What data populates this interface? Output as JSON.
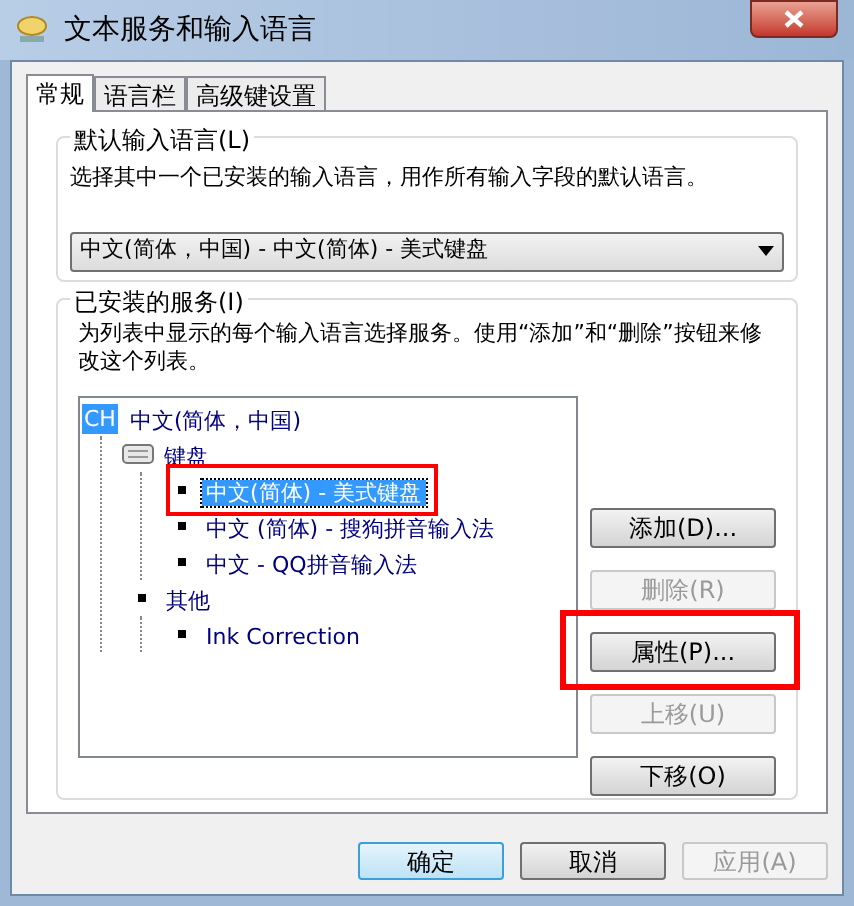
{
  "window": {
    "title": "文本服务和输入语言"
  },
  "tabs": [
    {
      "label": "常规",
      "selected": true
    },
    {
      "label": "语言栏",
      "selected": false
    },
    {
      "label": "高级键设置",
      "selected": false
    }
  ],
  "default_language": {
    "title": "默认输入语言(L)",
    "description": "选择其中一个已安装的输入语言，用作所有输入字段的默认语言。",
    "dropdown": {
      "value": "中文(简体，中国) - 中文(简体) - 美式键盘"
    }
  },
  "installed_services": {
    "title": "已安装的服务(I)",
    "description": "为列表中显示的每个输入语言选择服务。使用“添加”和“删除”按钮来修改这个列表。",
    "tree": [
      {
        "badge": "CH",
        "label": "中文(简体，中国)",
        "kind": "language",
        "selected": false,
        "highlighted": false,
        "children": [
          {
            "label": "键盘",
            "kind": "keyboard",
            "selected": false,
            "highlighted": false,
            "children": [
              {
                "label": "中文(简体) - 美式键盘",
                "kind": "item",
                "selected": true,
                "highlighted": true
              },
              {
                "label": "中文 (简体) - 搜狗拼音输入法",
                "kind": "item",
                "selected": false,
                "highlighted": false
              },
              {
                "label": "中文 - QQ拼音输入法",
                "kind": "item",
                "selected": false,
                "highlighted": false
              }
            ]
          },
          {
            "label": "其他",
            "kind": "item",
            "selected": false,
            "highlighted": false,
            "children": [
              {
                "label": "Ink Correction",
                "kind": "item",
                "selected": false,
                "highlighted": false
              }
            ]
          }
        ]
      }
    ],
    "buttons": [
      {
        "label": "添加(D)...",
        "disabled": false,
        "highlighted": false
      },
      {
        "label": "删除(R)",
        "disabled": true,
        "highlighted": false
      },
      {
        "label": "属性(P)...",
        "disabled": false,
        "highlighted": true
      },
      {
        "label": "上移(U)",
        "disabled": true,
        "highlighted": false
      },
      {
        "label": "下移(O)",
        "disabled": false,
        "highlighted": false
      }
    ]
  },
  "footer_buttons": [
    {
      "label": "确定",
      "default": true,
      "disabled": false
    },
    {
      "label": "取消",
      "default": false,
      "disabled": false
    },
    {
      "label": "应用(A)",
      "default": false,
      "disabled": true
    }
  ]
}
